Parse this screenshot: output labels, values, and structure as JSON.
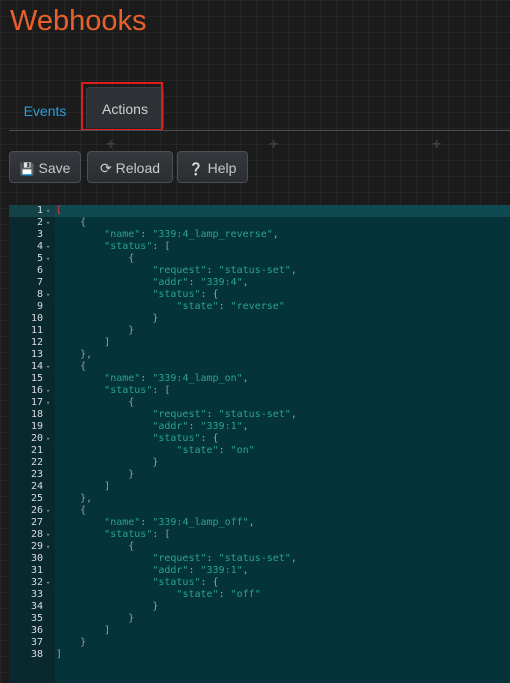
{
  "page": {
    "title": "Webhooks"
  },
  "tabs": [
    {
      "label": "Events"
    },
    {
      "label": "Actions",
      "active": true
    }
  ],
  "toolbar": {
    "save_label": "Save",
    "reload_label": "Reload",
    "help_label": "Help"
  },
  "editor": {
    "theme_colors": {
      "background": "#05333a",
      "gutter": "#0a292e",
      "keys": "#2aa198",
      "punct": "#93a1a1"
    },
    "actions": [
      {
        "name": "339:4_lamp_reverse",
        "request": "status-set",
        "addr": "339:4",
        "state": "reverse"
      },
      {
        "name": "339:4_lamp_on",
        "request": "status-set",
        "addr": "339:1",
        "state": "on"
      },
      {
        "name": "339:4_lamp_off",
        "request": "status-set",
        "addr": "339:1",
        "state": "off"
      }
    ]
  }
}
